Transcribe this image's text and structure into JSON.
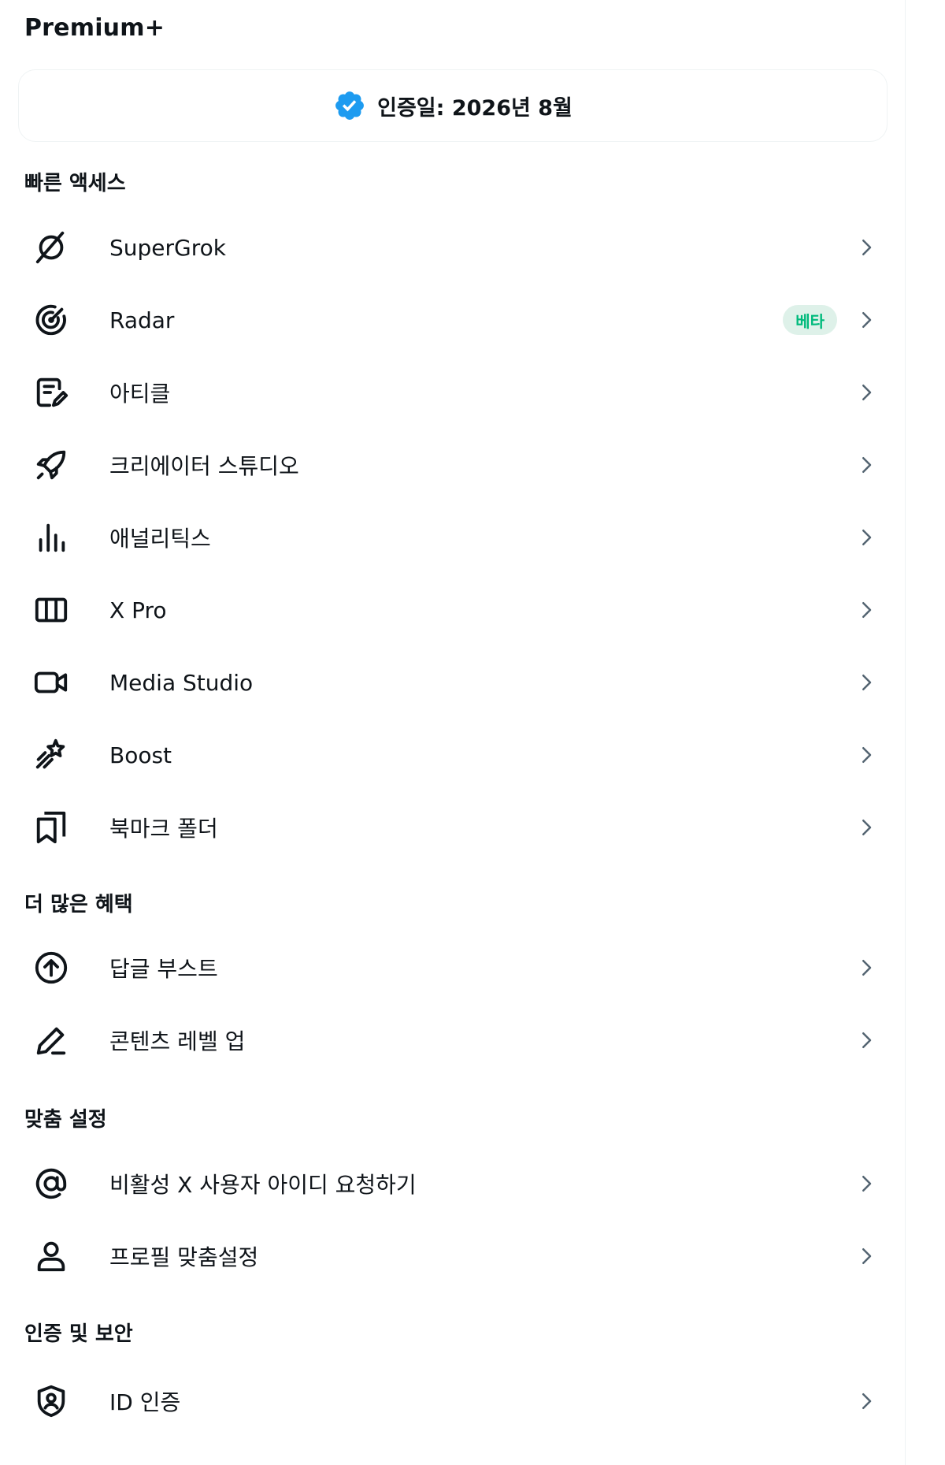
{
  "title": "Premium+",
  "verified": {
    "text": "인증일: 2026년 8월",
    "icon": "verified-badge-icon",
    "color": "#1d9bf0"
  },
  "sections": {
    "quick_access": {
      "title": "빠른 액세스",
      "items": [
        {
          "label": "SuperGrok",
          "icon": "grok-icon"
        },
        {
          "label": "Radar",
          "icon": "radar-icon",
          "badge": "베타"
        },
        {
          "label": "아티클",
          "icon": "article-icon"
        },
        {
          "label": "크리에이터 스튜디오",
          "icon": "rocket-icon"
        },
        {
          "label": "애널리틱스",
          "icon": "analytics-icon"
        },
        {
          "label": "X Pro",
          "icon": "columns-icon"
        },
        {
          "label": "Media Studio",
          "icon": "video-camera-icon"
        },
        {
          "label": "Boost",
          "icon": "boost-icon"
        },
        {
          "label": "북마크 폴더",
          "icon": "bookmark-folder-icon"
        }
      ]
    },
    "more_benefits": {
      "title": "더 많은 혜택",
      "items": [
        {
          "label": "답글 부스트",
          "icon": "arrow-up-circle-icon"
        },
        {
          "label": "콘텐츠 레벨 업",
          "icon": "pencil-icon"
        }
      ]
    },
    "customization": {
      "title": "맞춤 설정",
      "items": [
        {
          "label": "비활성 X 사용자 아이디 요청하기",
          "icon": "at-sign-icon"
        },
        {
          "label": "프로필 맞춤설정",
          "icon": "person-icon"
        }
      ]
    },
    "verification_security": {
      "title": "인증 및 보안",
      "items": [
        {
          "label": "ID 인증",
          "icon": "shield-person-icon"
        }
      ]
    }
  },
  "colors": {
    "text": "#0f1419",
    "chevron": "#536471",
    "beta_bg": "#def1e9",
    "beta_text": "#00ba7c",
    "border": "#eff3f4"
  }
}
